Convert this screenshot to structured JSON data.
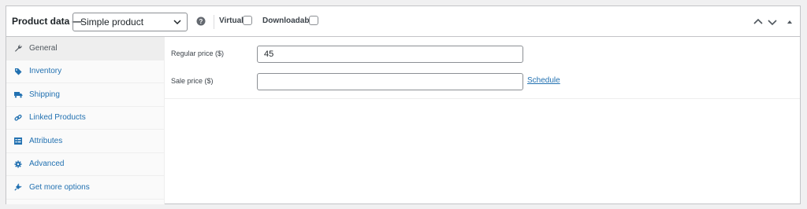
{
  "header": {
    "title": "Product data —",
    "product_type": "Simple product",
    "virtual_label": "Virtual:",
    "downloadable_label": "Downloadable:"
  },
  "tabs": [
    {
      "label": "General",
      "icon": "wrench-icon",
      "active": true
    },
    {
      "label": "Inventory",
      "icon": "tag-icon",
      "active": false
    },
    {
      "label": "Shipping",
      "icon": "truck-icon",
      "active": false
    },
    {
      "label": "Linked Products",
      "icon": "link-icon",
      "active": false
    },
    {
      "label": "Attributes",
      "icon": "list-icon",
      "active": false
    },
    {
      "label": "Advanced",
      "icon": "gear-icon",
      "active": false
    },
    {
      "label": "Get more options",
      "icon": "plugin-icon",
      "active": false
    }
  ],
  "general": {
    "regular_price_label": "Regular price ($)",
    "regular_price_value": "45",
    "sale_price_label": "Sale price ($)",
    "sale_price_value": "",
    "schedule_link": "Schedule"
  },
  "colors": {
    "link": "#2271b1",
    "border": "#c3c4c7",
    "icon": "#787c82"
  }
}
